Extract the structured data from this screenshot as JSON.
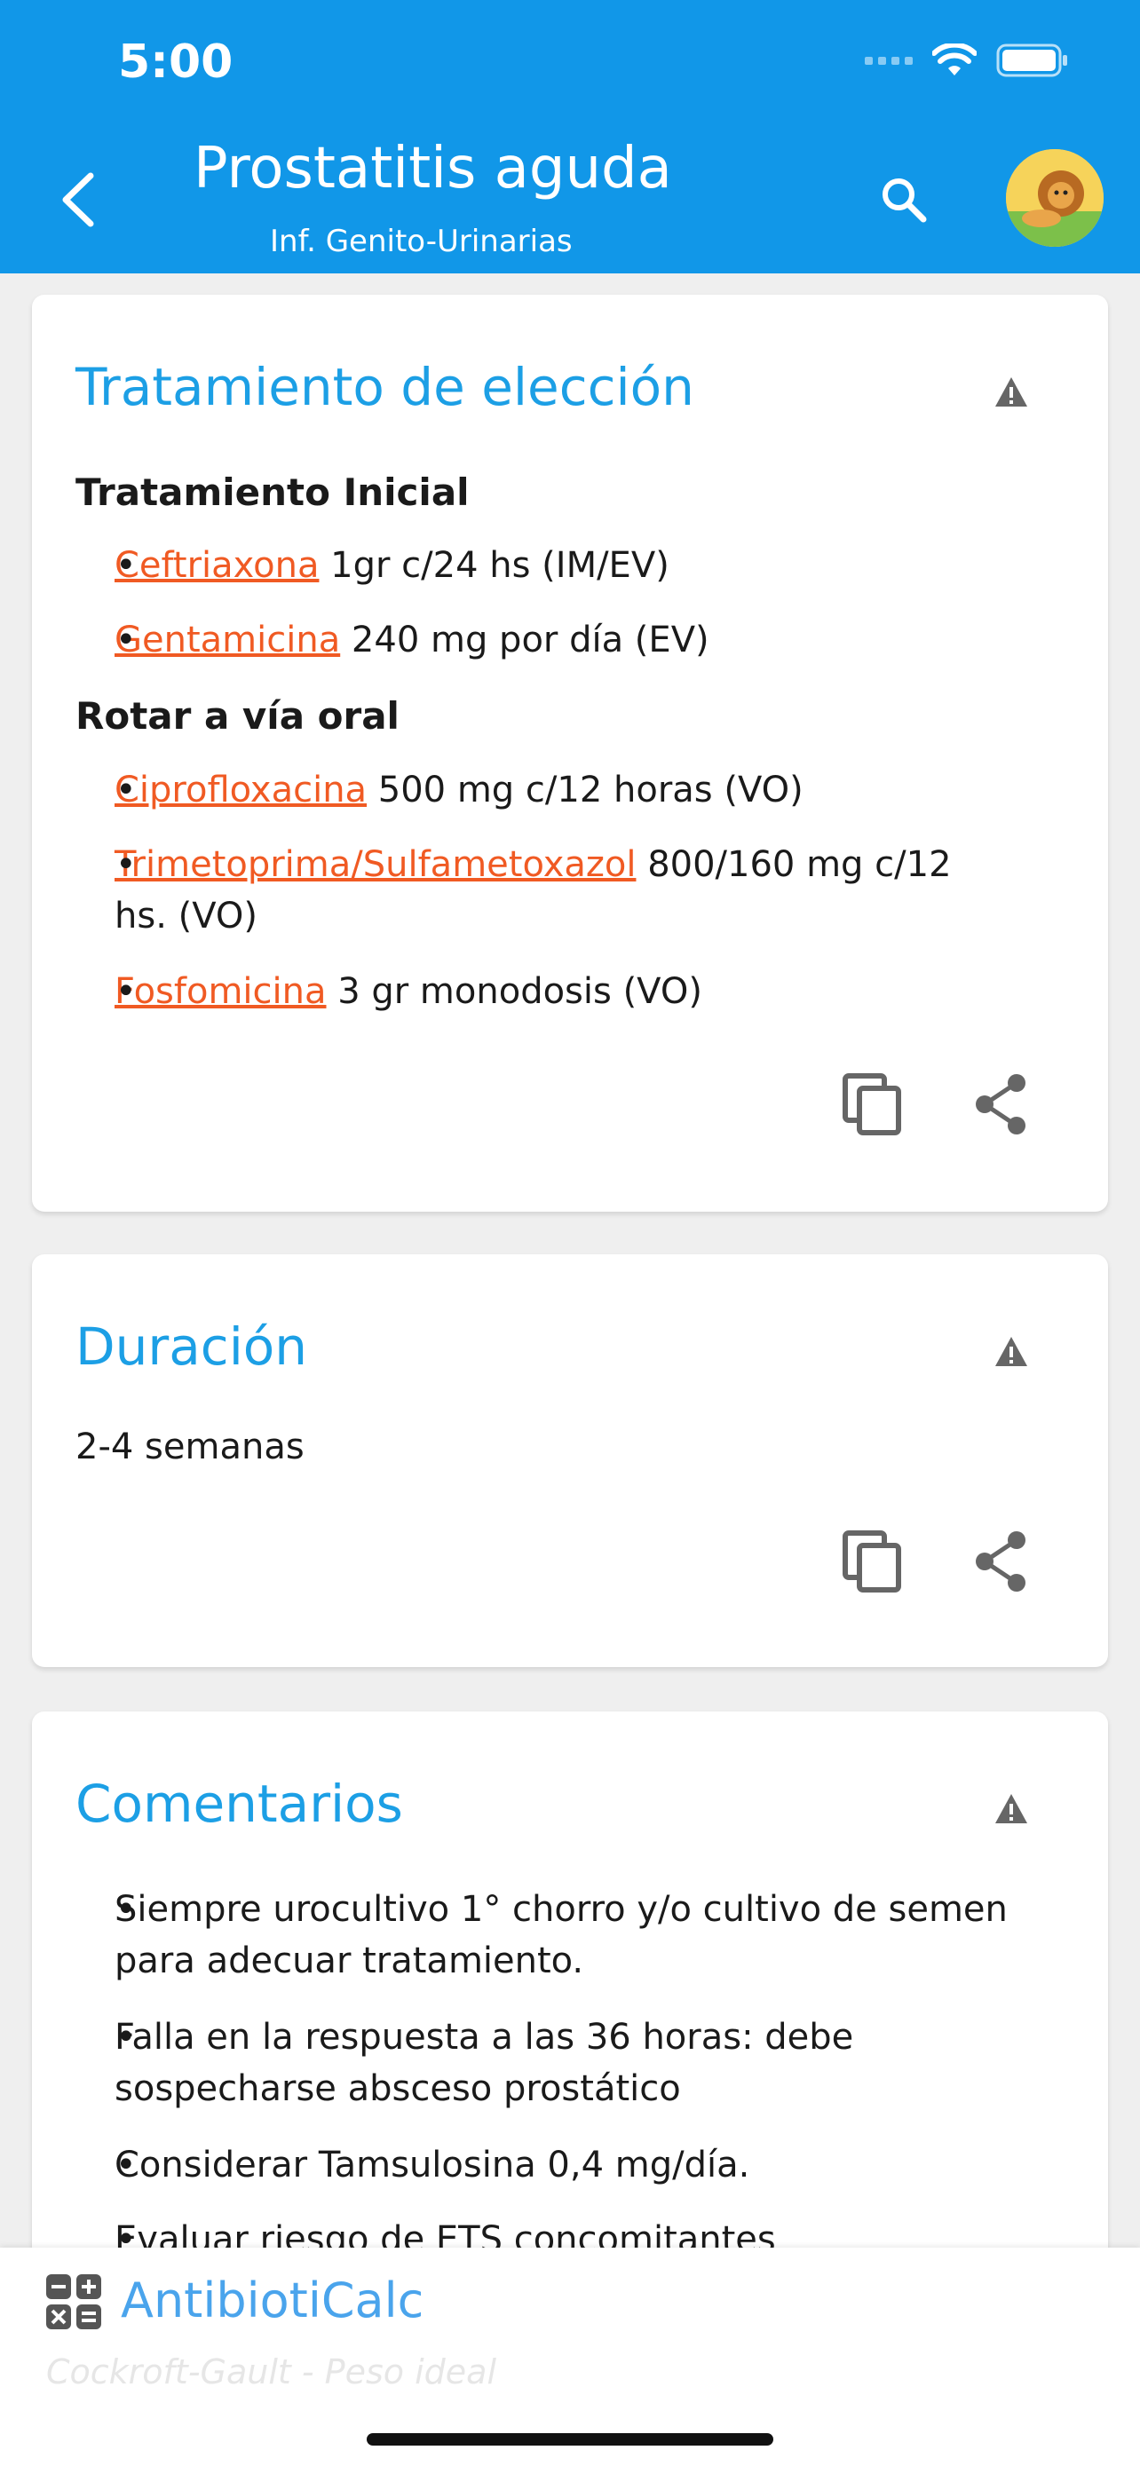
{
  "status_bar": {
    "time": "5:00"
  },
  "header": {
    "title": "Prostatitis aguda",
    "subtitle": "Inf. Genito-Urinarias"
  },
  "cards": {
    "treatment": {
      "title": "Tratamiento de elección",
      "initial": {
        "heading": "Tratamiento Inicial",
        "items": [
          {
            "drug": "Ceftriaxona",
            "dose": "1gr c/24 hs (IM/EV)"
          },
          {
            "drug": "Gentamicina",
            "dose": "240 mg por día (EV)"
          }
        ]
      },
      "oral": {
        "heading": "Rotar a vía oral",
        "items": [
          {
            "drug": "Ciprofloxacina",
            "dose": "500 mg c/12 horas (VO)"
          },
          {
            "drug": "Trimetoprima/Sulfametoxazol",
            "dose": "800/160 mg c/12 hs. (VO)"
          },
          {
            "drug": "Fosfomicina",
            "dose": "3 gr monodosis (VO)"
          }
        ]
      }
    },
    "duration": {
      "title": "Duración",
      "text": "2-4 semanas"
    },
    "comments": {
      "title": "Comentarios",
      "items": [
        "Siempre urocultivo 1° chorro y/o cultivo de semen para adecuar tratamiento.",
        "Falla en la respuesta a las 36 horas: debe sospecharse absceso prostático",
        "Considerar Tamsulosina 0,4 mg/día.",
        "Evaluar riesgo de ETS concomitantes"
      ]
    }
  },
  "bottom_bar": {
    "brand": "AntibiotiCalc",
    "ghost_text": "Cockroft-Gault - Peso ideal"
  },
  "icons": {
    "back": "chevron-left-icon",
    "search": "search-icon",
    "warning": "warning-icon",
    "copy": "copy-icon",
    "share": "share-icon",
    "calculator": "calculator-icon"
  },
  "colors": {
    "header": "#1197e8",
    "card_title": "#1c9fe5",
    "drug_link": "#f05a23",
    "brand": "#4aa4ec"
  }
}
